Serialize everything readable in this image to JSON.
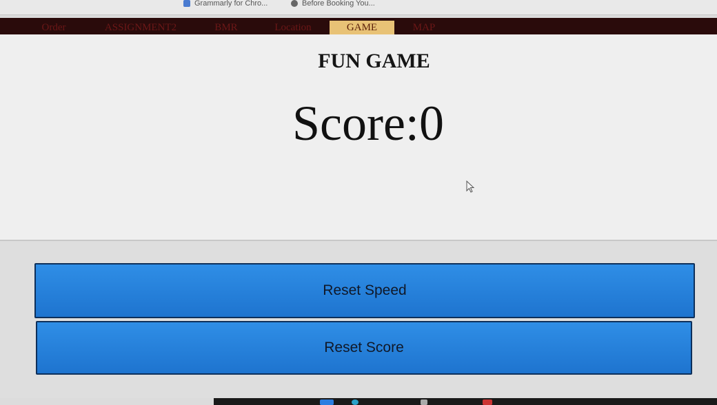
{
  "bookmarks": {
    "items": [
      {
        "label": "Grammarly for Chro...",
        "icon": "grammarly-icon"
      },
      {
        "label": "Before Booking You...",
        "icon": "globe-icon"
      }
    ]
  },
  "nav": {
    "items": [
      {
        "label": "Order"
      },
      {
        "label": "ASSIGNMENT2"
      },
      {
        "label": "BMR"
      },
      {
        "label": "Location"
      },
      {
        "label": "GAME",
        "active": true
      },
      {
        "label": "MAP"
      }
    ]
  },
  "main": {
    "title": "FUN GAME",
    "score_text": "Score:0"
  },
  "buttons": {
    "reset_speed": "Reset Speed",
    "reset_score": "Reset Score"
  },
  "colors": {
    "nav_background": "#2a0b0b",
    "nav_active": "#e8c276",
    "button": "#2a85e0"
  }
}
